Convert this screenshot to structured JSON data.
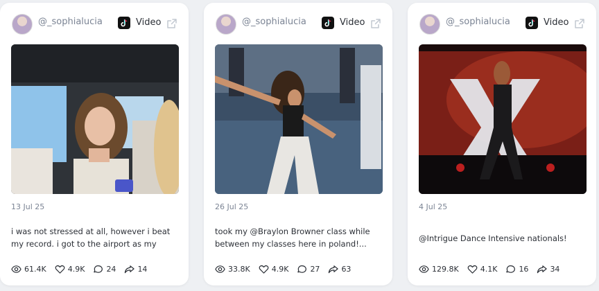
{
  "cards": [
    {
      "handle": "@_sophialucia",
      "platform_label": "Video",
      "date": "13 Jul 25",
      "caption": "i was not stressed at all, however i beat my record. i got to the airport as my flig...",
      "stats": {
        "views": "61.4K",
        "likes": "4.9K",
        "comments": "24",
        "shares": "14"
      }
    },
    {
      "handle": "@_sophialucia",
      "platform_label": "Video",
      "date": "26 Jul 25",
      "caption": "took my @Braylon Browner class while between my classes here in poland!...",
      "stats": {
        "views": "33.8K",
        "likes": "4.9K",
        "comments": "27",
        "shares": "63"
      }
    },
    {
      "handle": "@_sophialucia",
      "platform_label": "Video",
      "date": "4 Jul 25",
      "caption": "@Intrigue Dance Intensive nationals!",
      "stats": {
        "views": "129.8K",
        "likes": "4.1K",
        "comments": "16",
        "shares": "34"
      }
    }
  ],
  "icons": {
    "platform": "tiktok-icon",
    "external": "external-link-icon",
    "views": "eye-icon",
    "likes": "heart-icon",
    "comments": "comment-icon",
    "shares": "share-icon"
  }
}
